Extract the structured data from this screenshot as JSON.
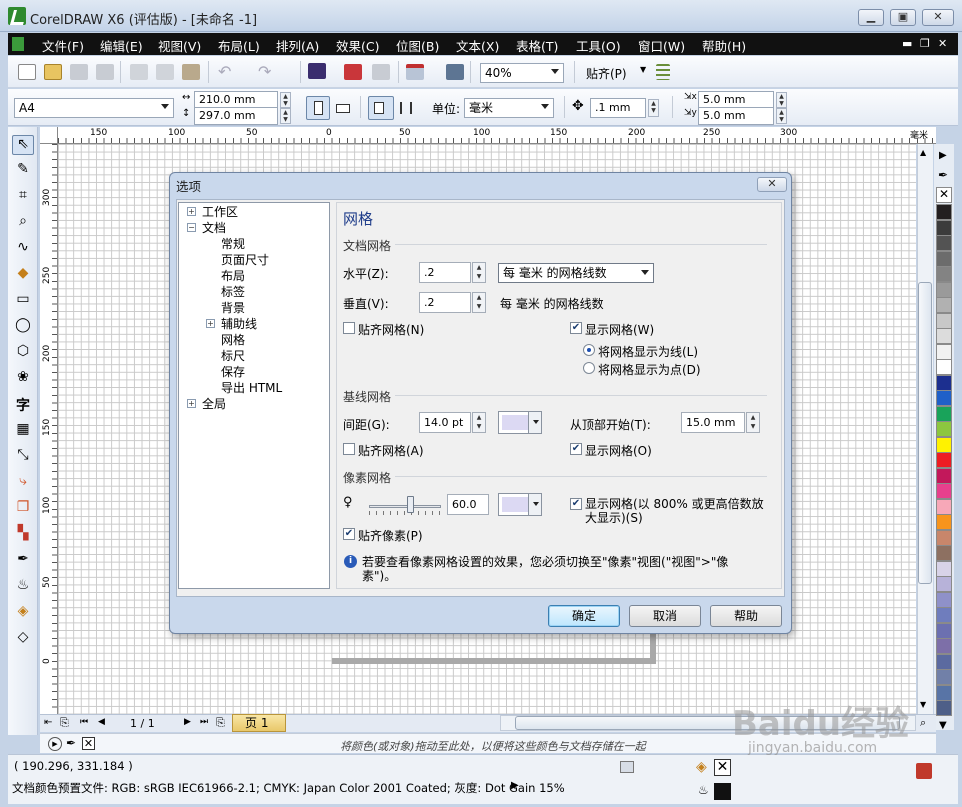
{
  "window": {
    "title": "CorelDRAW X6 (评估版) - [未命名 -1]",
    "min": "▭",
    "max": "▣",
    "close": "✕"
  },
  "menu": [
    "文件(F)",
    "编辑(E)",
    "视图(V)",
    "布局(L)",
    "排列(A)",
    "效果(C)",
    "位图(B)",
    "文本(X)",
    "表格(T)",
    "工具(O)",
    "窗口(W)",
    "帮助(H)"
  ],
  "toolbar": {
    "zoom": "40%",
    "snap": "贴齐(P)"
  },
  "propertybar": {
    "paper_size": "A4",
    "width": "210.0 mm",
    "height": "297.0 mm",
    "unit_label": "单位:",
    "unit": "毫米",
    "nudge": ".1 mm",
    "dup_x": "5.0 mm",
    "dup_y": "5.0 mm"
  },
  "ruler": {
    "top": [
      "150",
      "100",
      "50",
      "0",
      "50",
      "100",
      "150",
      "200",
      "250",
      "300"
    ],
    "top_unit": "毫米",
    "left": [
      "300",
      "250",
      "200",
      "150",
      "100",
      "50",
      "0"
    ]
  },
  "pagebar": {
    "page_count": "1 / 1",
    "page_tab": "页 1"
  },
  "hint": "将颜色(或对象)拖动至此处，以便将这些颜色与文档存储在一起",
  "status": {
    "coords": "( 190.296, 331.184 )",
    "color_profile": "文档颜色预置文件: RGB: sRGB IEC61966-2.1; CMYK: Japan Color 2001 Coated; 灰度: Dot Gain 15%"
  },
  "watermark": {
    "brand": "Baidu经验",
    "url": "jingyan.baidu.com"
  },
  "dialog": {
    "title": "选项",
    "tree": [
      {
        "label": "工作区",
        "expander": "+"
      },
      {
        "label": "文档",
        "expander": "-"
      },
      {
        "label": "常规"
      },
      {
        "label": "页面尺寸"
      },
      {
        "label": "布局"
      },
      {
        "label": "标签"
      },
      {
        "label": "背景"
      },
      {
        "label": "辅助线",
        "expander": "+"
      },
      {
        "label": "网格"
      },
      {
        "label": "标尺"
      },
      {
        "label": "保存"
      },
      {
        "label": "导出 HTML"
      },
      {
        "label": "全局",
        "expander": "+"
      }
    ],
    "panel": {
      "heading": "网格",
      "doc_grid": {
        "group": "文档网格",
        "horizontal_label": "水平(Z):",
        "horizontal_value": ".2",
        "horizontal_mode": "每 毫米 的网格线数",
        "vertical_label": "垂直(V):",
        "vertical_value": ".2",
        "vertical_mode": "每 毫米 的网格线数",
        "snap": "贴齐网格(N)",
        "show": "显示网格(W)",
        "as_lines": "将网格显示为线(L)",
        "as_dots": "将网格显示为点(D)"
      },
      "baseline_grid": {
        "group": "基线网格",
        "spacing_label": "间距(G):",
        "spacing_value": "14.0 pt",
        "from_top_label": "从顶部开始(T):",
        "from_top_value": "15.0 mm",
        "snap": "贴齐网格(A)",
        "show": "显示网格(O)"
      },
      "pixel_grid": {
        "group": "像素网格",
        "opacity_value": "60.0",
        "show": "显示网格(以 800% 或更高倍数放大显示)(S)",
        "snap": "贴齐像素(P)"
      },
      "info": "若要查看像素网格设置的效果，您必须切换至\"像素\"视图(\"视图\">\"像素\")。"
    },
    "buttons": {
      "ok": "确定",
      "cancel": "取消",
      "help": "帮助"
    }
  },
  "palette": [
    "#231f20",
    "#3c3c3c",
    "#535353",
    "#6c6c6c",
    "#838383",
    "#9a9a9a",
    "#b1b1b1",
    "#c8c8c8",
    "#dcdcdc",
    "#f1f1f1",
    "#ffffff",
    "#1c2f8f",
    "#2060c8",
    "#19a35a",
    "#8cc63f",
    "#fff200",
    "#ed1c24",
    "#c2185b",
    "#e7408d",
    "#f7a8b8",
    "#f7941d",
    "#c8866b",
    "#8d7061",
    "#d8d3e8",
    "#b7b2d9",
    "#8f91c9",
    "#6f7dbd",
    "#6c70b0",
    "#7d6fa8",
    "#5b6aa0",
    "#7180a8",
    "#5874a6",
    "#4e5f88"
  ],
  "colors": {
    "titlebar": "#c3d3e8",
    "menubar": "#111111",
    "accent": "#1d4fb0",
    "page_tab": "#e9c86a"
  }
}
